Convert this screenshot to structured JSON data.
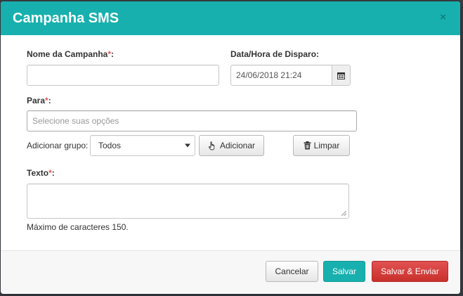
{
  "modal": {
    "title": "Campanha SMS",
    "close_glyph": "×"
  },
  "form": {
    "nome": {
      "label": "Nome da Campanha",
      "required_mark": "*",
      "suffix": ":",
      "value": ""
    },
    "data_hora": {
      "label": "Data/Hora de Disparo:",
      "value": "24/06/2018 21:24",
      "addon_icon": "calendar-icon"
    },
    "para": {
      "label": "Para",
      "required_mark": "*",
      "suffix": ":",
      "placeholder": "Selecione suas opções"
    },
    "grupo": {
      "label": "Adicionar grupo:",
      "selected": "Todos"
    },
    "adicionar_button": {
      "label": "Adicionar",
      "icon": "hand-pointer-icon"
    },
    "limpar_button": {
      "label": "Limpar",
      "icon": "trash-icon"
    },
    "texto": {
      "label": "Texto",
      "required_mark": "*",
      "suffix": ":",
      "value": "",
      "hint": "Máximo de caracteres 150."
    }
  },
  "footer": {
    "cancel_label": "Cancelar",
    "save_label": "Salvar",
    "save_send_label": "Salvar & Enviar"
  },
  "colors": {
    "header": "#17b0ae",
    "primary": "#17b0ae",
    "danger": "#d9534f",
    "required": "#e25555"
  }
}
